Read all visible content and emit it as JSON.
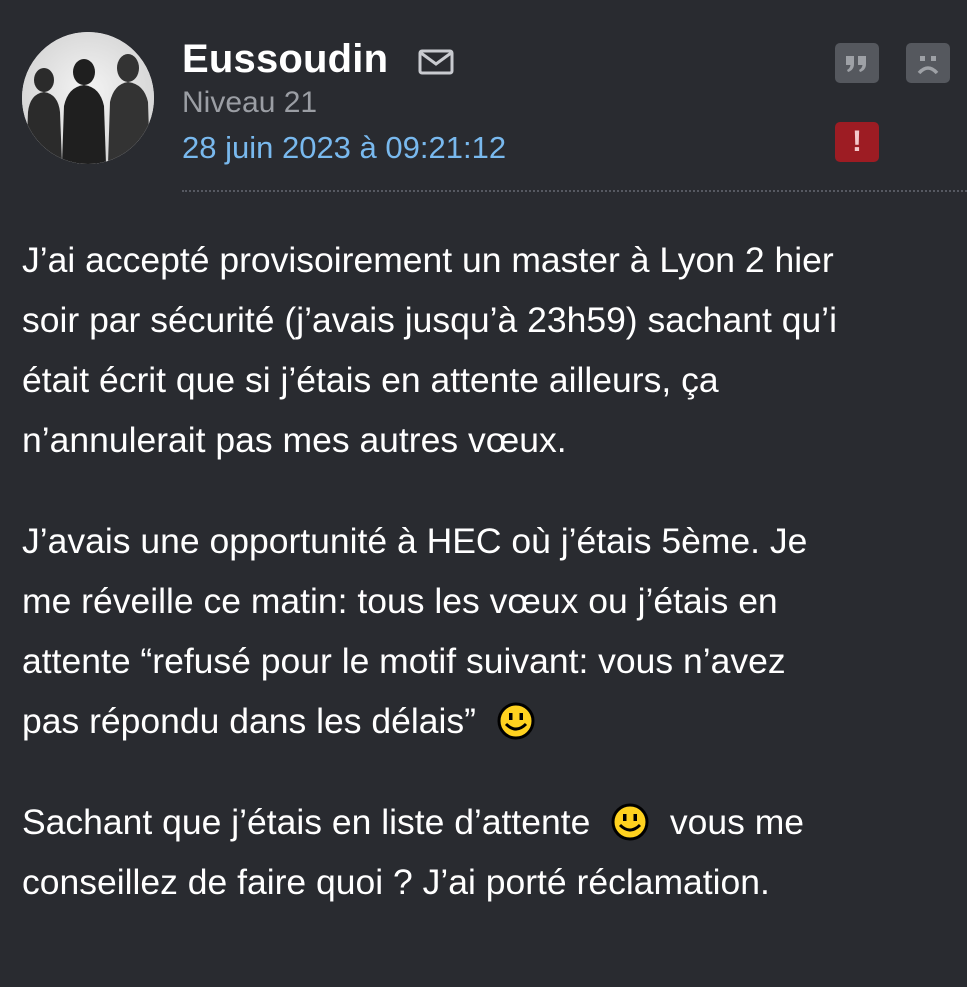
{
  "post": {
    "author": "Eussoudin",
    "level": "Niveau 21",
    "date": "28 juin 2023 à 09:21:12",
    "icons": {
      "mail": "mail-icon",
      "quote": "quote-icon",
      "sad": "sad-face-icon",
      "report": "exclamation-icon",
      "smiley": "smiley-icon"
    },
    "colors": {
      "background": "#292b30",
      "date_link": "#79b9ee",
      "level_text": "#9b9ea4",
      "action_button": "#55585e",
      "report_button": "#9d1c23"
    },
    "body": {
      "p1": [
        "J’ai accepté provisoirement un master à Lyon 2 hier",
        "soir par sécurité (j’avais jusqu’à 23h59) sachant qu’i",
        "était écrit que si j’étais en attente ailleurs, ça",
        "n’annulerait pas mes autres vœux."
      ],
      "p2": [
        "J’avais une opportunité à HEC où j’étais 5ème. Je",
        "me réveille ce matin: tous les vœux ou j’étais en",
        "attente “refusé pour le motif suivant: vous n’avez",
        "pas répondu dans les délais”"
      ],
      "p3": {
        "line1_before": "Sachant que j’étais en liste d’attente",
        "line1_after": "vous me",
        "line2": "conseillez de faire quoi ? J’ai porté réclamation."
      }
    }
  }
}
